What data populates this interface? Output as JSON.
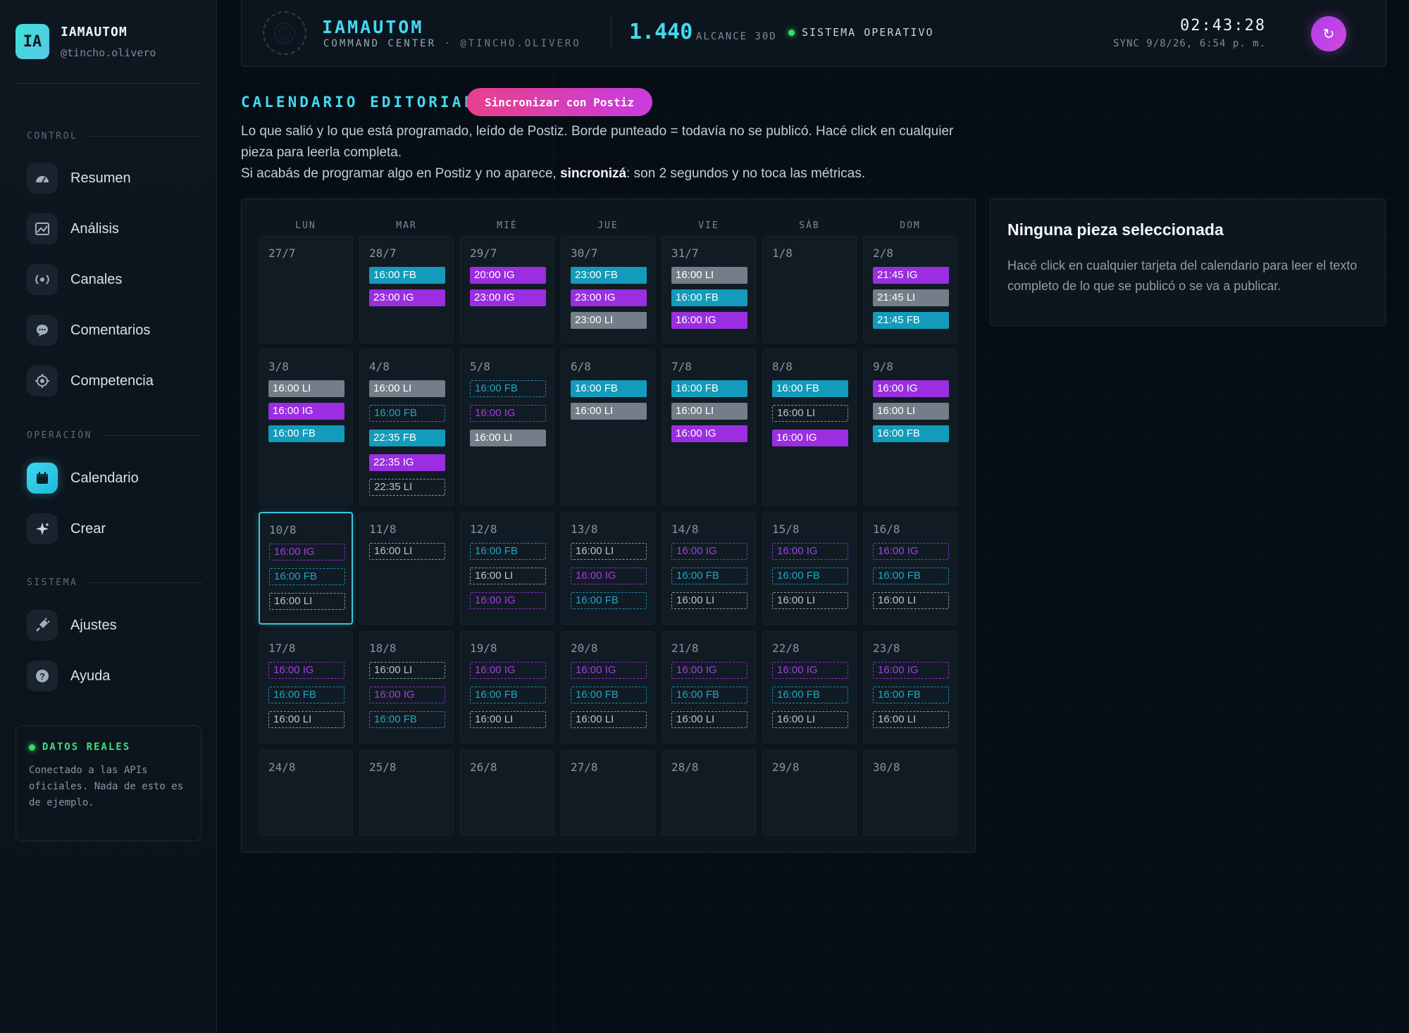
{
  "brand": {
    "logo": "IA",
    "name": "IAMAUTOM",
    "handle": "@tincho.olivero"
  },
  "nav": {
    "sections": [
      {
        "label": "CONTROL",
        "items": [
          {
            "label": "Resumen",
            "icon": "dashboard-icon"
          },
          {
            "label": "Análisis",
            "icon": "image-chart-icon"
          },
          {
            "label": "Canales",
            "icon": "broadcast-icon"
          },
          {
            "label": "Comentarios",
            "icon": "chat-bubble-icon"
          },
          {
            "label": "Competencia",
            "icon": "target-icon"
          }
        ]
      },
      {
        "label": "OPERACIÓN",
        "items": [
          {
            "label": "Calendario",
            "icon": "calendar-icon",
            "active": true
          },
          {
            "label": "Crear",
            "icon": "sparkle-icon"
          }
        ]
      },
      {
        "label": "SISTEMA",
        "items": [
          {
            "label": "Ajustes",
            "icon": "plug-icon"
          },
          {
            "label": "Ayuda",
            "icon": "help-icon"
          }
        ]
      }
    ]
  },
  "real_data": {
    "title": "DATOS REALES",
    "text": "Conectado a las APIs oficiales. Nada de esto es de ejemplo."
  },
  "topbar": {
    "title": "IAMAUTOM",
    "subtitle": "COMMAND CENTER",
    "handle": "· @TINCHO.OLIVERO",
    "reach_value": "1.440",
    "reach_label": "ALCANCE 30D",
    "status": "SISTEMA OPERATIVO",
    "clock": "02:43:28",
    "sync": "SYNC 9/8/26, 6:54 p. m."
  },
  "page": {
    "title": "CALENDARIO EDITORIAL",
    "sync_button": "Sincronizar con Postiz",
    "desc_line1": "Lo que salió y lo que está programado, leído de Postiz. Borde punteado = todavía no se publicó. Hacé click en cualquier pieza para leerla completa.",
    "desc_line2_pre": "Si acabás de programar algo en Postiz y no aparece, ",
    "desc_line2_bold": "sincronizá",
    "desc_line2_post": ": son 2 segundos y no toca las métricas."
  },
  "calendar": {
    "weekdays": [
      "LUN",
      "MAR",
      "MIÉ",
      "JUE",
      "VIE",
      "SÁB",
      "DOM"
    ],
    "weeks": [
      [
        {
          "date": "27/7",
          "posts": []
        },
        {
          "date": "28/7",
          "posts": [
            {
              "time": "16:00",
              "net": "FB",
              "done": true
            },
            {
              "time": "23:00",
              "net": "IG",
              "done": true
            }
          ]
        },
        {
          "date": "29/7",
          "posts": [
            {
              "time": "20:00",
              "net": "IG",
              "done": true
            },
            {
              "time": "23:00",
              "net": "IG",
              "done": true
            }
          ]
        },
        {
          "date": "30/7",
          "posts": [
            {
              "time": "23:00",
              "net": "FB",
              "done": true
            },
            {
              "time": "23:00",
              "net": "IG",
              "done": true
            },
            {
              "time": "23:00",
              "net": "LI",
              "done": true
            }
          ]
        },
        {
          "date": "31/7",
          "posts": [
            {
              "time": "16:00",
              "net": "LI",
              "done": true
            },
            {
              "time": "16:00",
              "net": "FB",
              "done": true
            },
            {
              "time": "16:00",
              "net": "IG",
              "done": true
            }
          ]
        },
        {
          "date": "1/8",
          "posts": []
        },
        {
          "date": "2/8",
          "posts": [
            {
              "time": "21:45",
              "net": "IG",
              "done": true
            },
            {
              "time": "21:45",
              "net": "LI",
              "done": true
            },
            {
              "time": "21:45",
              "net": "FB",
              "done": true
            }
          ]
        }
      ],
      [
        {
          "date": "3/8",
          "posts": [
            {
              "time": "16:00",
              "net": "LI",
              "done": true
            },
            {
              "time": "16:00",
              "net": "IG",
              "done": true
            },
            {
              "time": "16:00",
              "net": "FB",
              "done": true
            }
          ]
        },
        {
          "date": "4/8",
          "posts": [
            {
              "time": "16:00",
              "net": "LI",
              "done": true
            },
            {
              "time": "16:00",
              "net": "FB",
              "done": false
            },
            {
              "time": "22:35",
              "net": "FB",
              "done": true
            },
            {
              "time": "22:35",
              "net": "IG",
              "done": true
            },
            {
              "time": "22:35",
              "net": "LI",
              "done": false
            }
          ]
        },
        {
          "date": "5/8",
          "posts": [
            {
              "time": "16:00",
              "net": "FB",
              "done": false
            },
            {
              "time": "16:00",
              "net": "IG",
              "done": false
            },
            {
              "time": "16:00",
              "net": "LI",
              "done": true
            }
          ]
        },
        {
          "date": "6/8",
          "posts": [
            {
              "time": "16:00",
              "net": "FB",
              "done": true
            },
            {
              "time": "16:00",
              "net": "LI",
              "done": true
            }
          ]
        },
        {
          "date": "7/8",
          "posts": [
            {
              "time": "16:00",
              "net": "FB",
              "done": true
            },
            {
              "time": "16:00",
              "net": "LI",
              "done": true
            },
            {
              "time": "16:00",
              "net": "IG",
              "done": true
            }
          ]
        },
        {
          "date": "8/8",
          "posts": [
            {
              "time": "16:00",
              "net": "FB",
              "done": true
            },
            {
              "time": "16:00",
              "net": "LI",
              "done": false
            },
            {
              "time": "16:00",
              "net": "IG",
              "done": true
            }
          ]
        },
        {
          "date": "9/8",
          "posts": [
            {
              "time": "16:00",
              "net": "IG",
              "done": true
            },
            {
              "time": "16:00",
              "net": "LI",
              "done": true
            },
            {
              "time": "16:00",
              "net": "FB",
              "done": true
            }
          ]
        }
      ],
      [
        {
          "date": "10/8",
          "today": true,
          "posts": [
            {
              "time": "16:00",
              "net": "IG",
              "done": false
            },
            {
              "time": "16:00",
              "net": "FB",
              "done": false
            },
            {
              "time": "16:00",
              "net": "LI",
              "done": false
            }
          ]
        },
        {
          "date": "11/8",
          "posts": [
            {
              "time": "16:00",
              "net": "LI",
              "done": false
            }
          ]
        },
        {
          "date": "12/8",
          "posts": [
            {
              "time": "16:00",
              "net": "FB",
              "done": false
            },
            {
              "time": "16:00",
              "net": "LI",
              "done": false
            },
            {
              "time": "16:00",
              "net": "IG",
              "done": false
            }
          ]
        },
        {
          "date": "13/8",
          "posts": [
            {
              "time": "16:00",
              "net": "LI",
              "done": false
            },
            {
              "time": "16:00",
              "net": "IG",
              "done": false
            },
            {
              "time": "16:00",
              "net": "FB",
              "done": false
            }
          ]
        },
        {
          "date": "14/8",
          "posts": [
            {
              "time": "16:00",
              "net": "IG",
              "done": false
            },
            {
              "time": "16:00",
              "net": "FB",
              "done": false
            },
            {
              "time": "16:00",
              "net": "LI",
              "done": false
            }
          ]
        },
        {
          "date": "15/8",
          "posts": [
            {
              "time": "16:00",
              "net": "IG",
              "done": false
            },
            {
              "time": "16:00",
              "net": "FB",
              "done": false
            },
            {
              "time": "16:00",
              "net": "LI",
              "done": false
            }
          ]
        },
        {
          "date": "16/8",
          "posts": [
            {
              "time": "16:00",
              "net": "IG",
              "done": false
            },
            {
              "time": "16:00",
              "net": "FB",
              "done": false
            },
            {
              "time": "16:00",
              "net": "LI",
              "done": false
            }
          ]
        }
      ],
      [
        {
          "date": "17/8",
          "posts": [
            {
              "time": "16:00",
              "net": "IG",
              "done": false
            },
            {
              "time": "16:00",
              "net": "FB",
              "done": false
            },
            {
              "time": "16:00",
              "net": "LI",
              "done": false
            }
          ]
        },
        {
          "date": "18/8",
          "posts": [
            {
              "time": "16:00",
              "net": "LI",
              "done": false
            },
            {
              "time": "16:00",
              "net": "IG",
              "done": false
            },
            {
              "time": "16:00",
              "net": "FB",
              "done": false
            }
          ]
        },
        {
          "date": "19/8",
          "posts": [
            {
              "time": "16:00",
              "net": "IG",
              "done": false
            },
            {
              "time": "16:00",
              "net": "FB",
              "done": false
            },
            {
              "time": "16:00",
              "net": "LI",
              "done": false
            }
          ]
        },
        {
          "date": "20/8",
          "posts": [
            {
              "time": "16:00",
              "net": "IG",
              "done": false
            },
            {
              "time": "16:00",
              "net": "FB",
              "done": false
            },
            {
              "time": "16:00",
              "net": "LI",
              "done": false
            }
          ]
        },
        {
          "date": "21/8",
          "posts": [
            {
              "time": "16:00",
              "net": "IG",
              "done": false
            },
            {
              "time": "16:00",
              "net": "FB",
              "done": false
            },
            {
              "time": "16:00",
              "net": "LI",
              "done": false
            }
          ]
        },
        {
          "date": "22/8",
          "posts": [
            {
              "time": "16:00",
              "net": "IG",
              "done": false
            },
            {
              "time": "16:00",
              "net": "FB",
              "done": false
            },
            {
              "time": "16:00",
              "net": "LI",
              "done": false
            }
          ]
        },
        {
          "date": "23/8",
          "posts": [
            {
              "time": "16:00",
              "net": "IG",
              "done": false
            },
            {
              "time": "16:00",
              "net": "FB",
              "done": false
            },
            {
              "time": "16:00",
              "net": "LI",
              "done": false
            }
          ]
        }
      ],
      [
        {
          "date": "24/8",
          "posts": []
        },
        {
          "date": "25/8",
          "posts": []
        },
        {
          "date": "26/8",
          "posts": []
        },
        {
          "date": "27/8",
          "posts": []
        },
        {
          "date": "28/8",
          "posts": []
        },
        {
          "date": "29/8",
          "posts": []
        },
        {
          "date": "30/8",
          "posts": []
        }
      ]
    ]
  },
  "detail": {
    "title": "Ninguna pieza seleccionada",
    "text": "Hacé click en cualquier tarjeta del calendario para leer el texto completo de lo que se publicó o se va a publicar."
  },
  "colors": {
    "accent": "#44d9f0",
    "fb": "#129bba",
    "ig": "#9a2ee0",
    "li": "#747e88",
    "pink": "#e8408a",
    "ok": "#2ee06a"
  }
}
